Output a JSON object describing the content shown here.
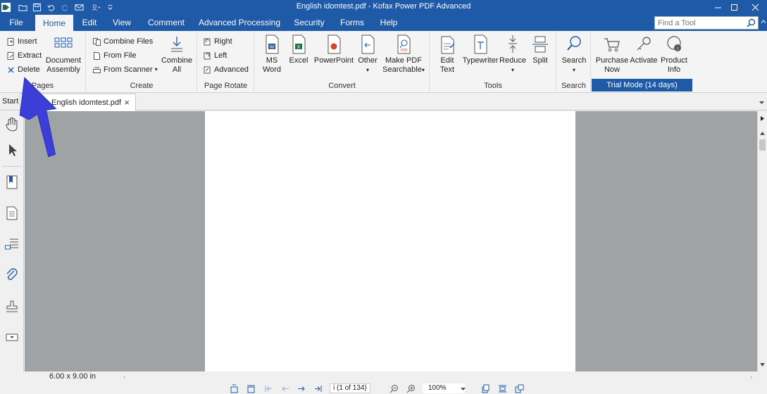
{
  "window": {
    "title": "English idomtest.pdf - Kofax Power PDF Advanced"
  },
  "menu_tabs": [
    "File",
    "Home",
    "Edit",
    "View",
    "Comment",
    "Advanced Processing",
    "Security",
    "Forms",
    "Help"
  ],
  "find_tool": {
    "placeholder": "Find a Tool"
  },
  "ribbon": {
    "pages": {
      "label": "Pages",
      "insert": "Insert",
      "extract": "Extract",
      "delete": "Delete",
      "document_assembly": [
        "Document",
        "Assembly"
      ]
    },
    "create": {
      "label": "Create",
      "combine_files": "Combine Files",
      "from_file": "From File",
      "from_scanner": "From Scanner",
      "combine_all": [
        "Combine",
        "All"
      ]
    },
    "page_rotate": {
      "label": "Page Rotate",
      "right": "Right",
      "left": "Left",
      "advanced": "Advanced"
    },
    "convert": {
      "label": "Convert",
      "ms_word": [
        "MS",
        "Word"
      ],
      "excel": "Excel",
      "powerpoint": "PowerPoint",
      "other": "Other",
      "make_pdf_searchable": [
        "Make PDF",
        "Searchable"
      ]
    },
    "tools": {
      "label": "Tools",
      "edit_text": [
        "Edit",
        "Text"
      ],
      "typewriter": "Typewriter",
      "reduce": "Reduce",
      "split": "Split"
    },
    "search": {
      "label": "Search",
      "search": "Search"
    },
    "trial": {
      "purchase_now": [
        "Purchase",
        "Now"
      ],
      "activate": "Activate",
      "product_info": [
        "Product",
        "Info"
      ],
      "label": "Trial Mode (14 days)"
    }
  },
  "doc_tabs": {
    "start": "Start",
    "file": "English idomtest.pdf",
    "close": "×"
  },
  "status": {
    "page_size": "6.00 x 9.00 in",
    "page_indicator": "i (1 of 134)",
    "zoom": "100%"
  },
  "colors": {
    "brand_blue": "#1e5aa8",
    "arrow": "#3b3fd8",
    "canvas_gray": "#a0a3a6"
  }
}
